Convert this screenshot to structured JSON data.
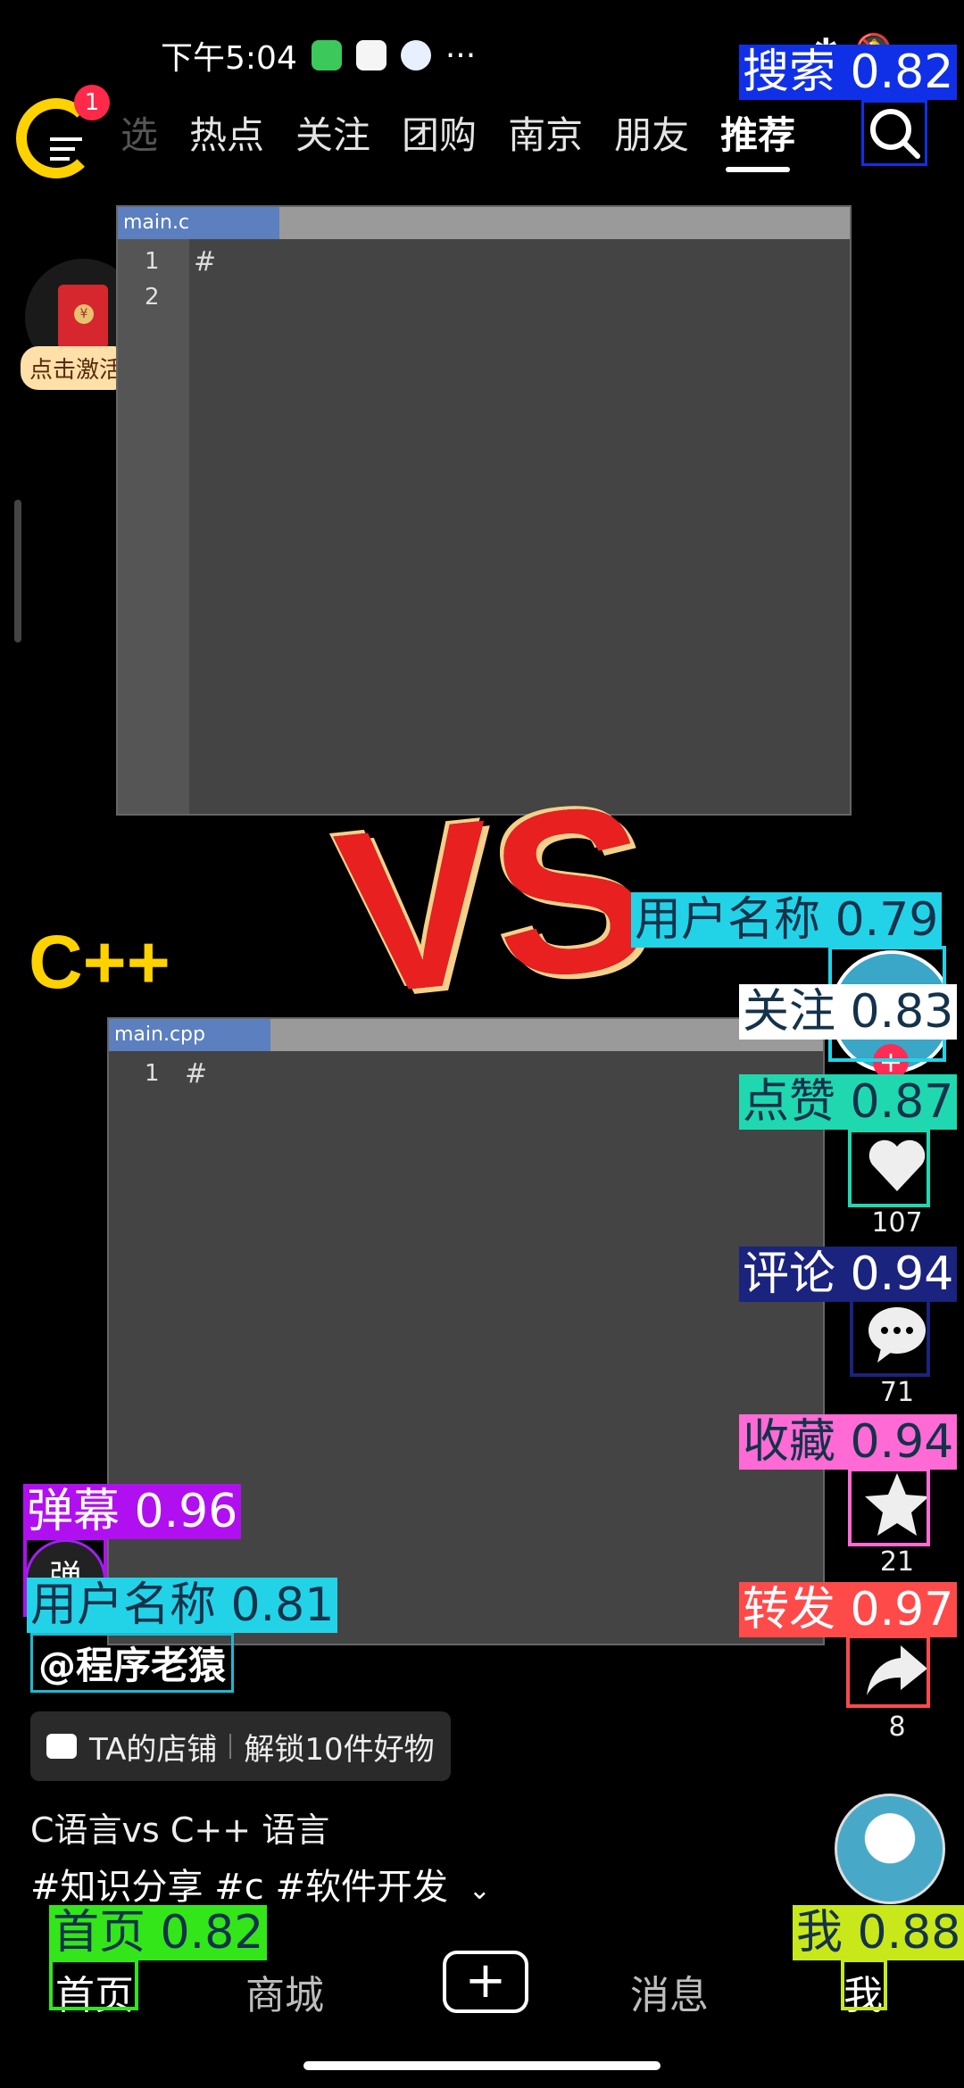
{
  "status_bar": {
    "time": "下午5:04",
    "more": "···"
  },
  "top_nav": {
    "badge_count": "1",
    "tabs": [
      "热点",
      "关注",
      "团购",
      "南京",
      "朋友",
      "推荐"
    ],
    "partial_tab": "选",
    "active_tab": "推荐"
  },
  "red_packet": {
    "label": "点击激活"
  },
  "video": {
    "editor1": {
      "filename": "main.c",
      "lines": [
        "1",
        "2"
      ],
      "content": "#"
    },
    "editor2": {
      "filename": "main.cpp",
      "lines": [
        "1"
      ],
      "content": "#"
    },
    "vs_text": "VS",
    "cpp_label": "C++"
  },
  "actions": {
    "like_count": "107",
    "comment_count": "71",
    "favorite_count": "21",
    "share_count": "8"
  },
  "post": {
    "danmu_label": "弹",
    "username": "@程序老猿",
    "shop_label": "TA的店铺",
    "shop_promo": "解锁10件好物",
    "description": "C语言vs C++ 语言",
    "tags": "#知识分享 #c #软件开发"
  },
  "bottom_nav": {
    "home": "首页",
    "mall": "商城",
    "plus": "+",
    "messages": "消息",
    "me": "我"
  },
  "detections": [
    {
      "label": "搜索 0.82",
      "color": "#1030e8"
    },
    {
      "label": "用户名称 0.79",
      "color": "#22d3e8"
    },
    {
      "label": "关注 0.83",
      "color": "#ffffff"
    },
    {
      "label": "点赞 0.87",
      "color": "#1fd8b0"
    },
    {
      "label": "评论 0.94",
      "color": "#1a237e"
    },
    {
      "label": "收藏 0.94",
      "color": "#ff6ad5"
    },
    {
      "label": "转发 0.97",
      "color": "#ff4a4a"
    },
    {
      "label": "弹幕 0.96",
      "color": "#b010f0"
    },
    {
      "label": "用户名称 0.81",
      "color": "#22d3e8"
    },
    {
      "label": "首页 0.82",
      "color": "#33e61a"
    },
    {
      "label": "我 0.88",
      "color": "#c8e81a"
    }
  ]
}
